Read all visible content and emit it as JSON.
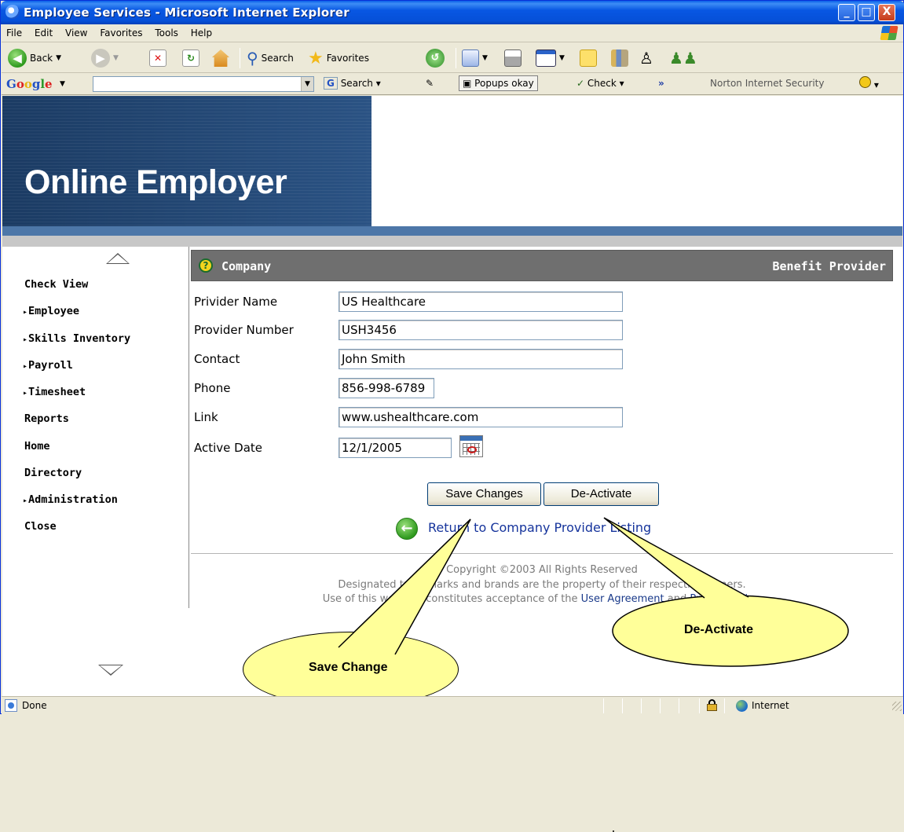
{
  "window": {
    "title": "Employee Services - Microsoft Internet Explorer",
    "min_label": "_",
    "max_label": "□",
    "close_label": "X"
  },
  "menu": [
    "File",
    "Edit",
    "View",
    "Favorites",
    "Tools",
    "Help"
  ],
  "toolbar": {
    "back_label": "Back",
    "search_label": "Search",
    "favorites_label": "Favorites"
  },
  "google_bar": {
    "logo": "Google",
    "search_value": "",
    "search_btn": "Search",
    "popups": "Popups okay",
    "check": "Check",
    "more": "»",
    "norton": "Norton Internet Security"
  },
  "banner": {
    "brand": "Online Employer"
  },
  "nav": {
    "items": [
      {
        "label": "Check View",
        "expandable": false
      },
      {
        "label": "Employee",
        "expandable": true
      },
      {
        "label": "Skills Inventory",
        "expandable": true
      },
      {
        "label": "Payroll",
        "expandable": true
      },
      {
        "label": "Timesheet",
        "expandable": true
      },
      {
        "label": "Reports",
        "expandable": false
      },
      {
        "label": "Home",
        "expandable": false
      },
      {
        "label": "Directory",
        "expandable": false
      },
      {
        "label": "Administration",
        "expandable": true
      },
      {
        "label": "Close",
        "expandable": false
      }
    ]
  },
  "section": {
    "left_title": "Company",
    "right_title": "Benefit Provider",
    "help_glyph": "?"
  },
  "form": {
    "provider_name": {
      "label": "Privider Name",
      "value": "US Healthcare"
    },
    "provider_number": {
      "label": "Provider Number",
      "value": "USH3456"
    },
    "contact": {
      "label": "Contact",
      "value": "John Smith"
    },
    "phone": {
      "label": "Phone",
      "value": "856-998-6789"
    },
    "link": {
      "label": "Link",
      "value": "www.ushealthcare.com"
    },
    "active_date": {
      "label": "Active Date",
      "value": "12/1/2005"
    }
  },
  "buttons": {
    "save": "Save Changes",
    "deactivate": "De-Activate"
  },
  "return_link": "Return to Company Provider Listing",
  "footer": {
    "line1": "Copyright ©2003 All Rights Reserved",
    "line2": "Designated trademarks and brands are the property of their respective owners.",
    "line3_prefix": "Use of this web site constitutes acceptance of the ",
    "user_agreement": "User Agreement",
    "and": " and ",
    "privacy_policy": "Privacy Policy",
    "line3_suffix": "."
  },
  "callouts": {
    "save": "Save Change",
    "deactivate": "De-Activate"
  },
  "status": {
    "text": "Done",
    "zone": "Internet"
  }
}
